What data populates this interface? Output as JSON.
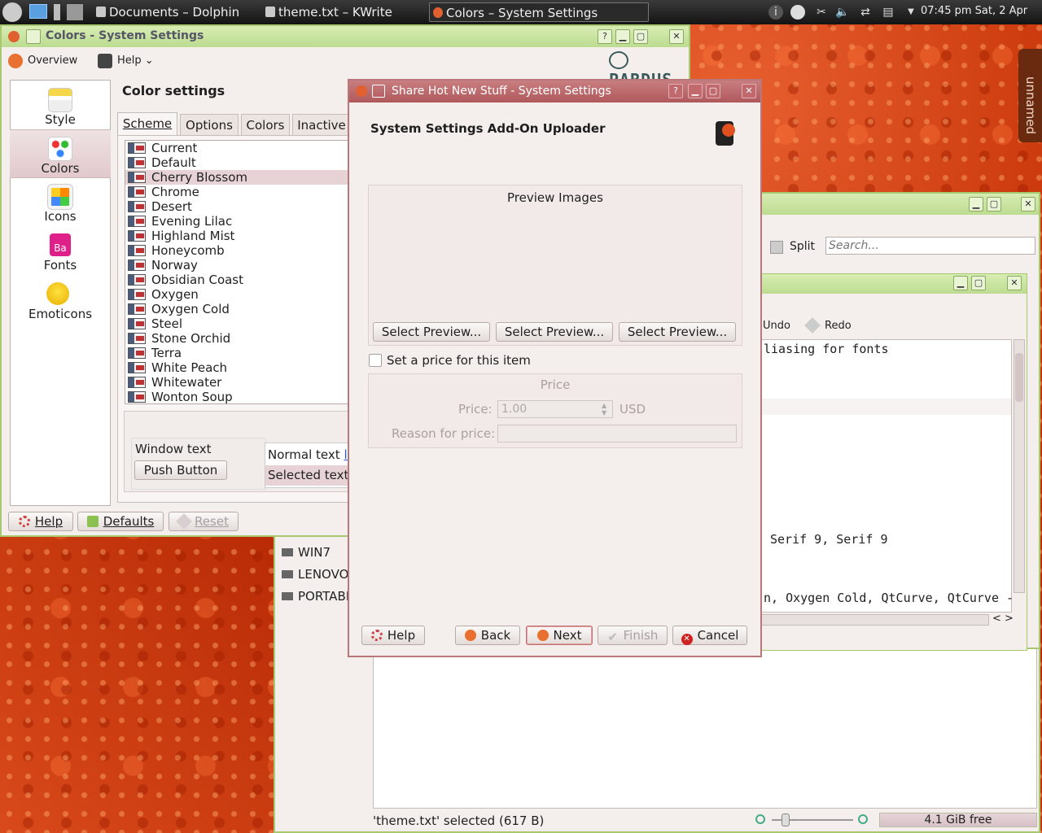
{
  "taskbar": {
    "tasks": [
      "Documents – Dolphin",
      "theme.txt – KWrite",
      "Colors – System Settings"
    ],
    "clock": "07:45 pm Sat, 2 Apr"
  },
  "desktop": {
    "side_tab": "unnamed"
  },
  "colors_window": {
    "title": "Colors - System Settings",
    "toolbar": {
      "overview": "Overview",
      "help": "Help"
    },
    "brand": "PARDUS",
    "categories": [
      {
        "label": "Style"
      },
      {
        "label": "Colors"
      },
      {
        "label": "Icons"
      },
      {
        "label": "Fonts"
      },
      {
        "label": "Emoticons"
      }
    ],
    "fonts_icon_text": "Ba",
    "heading": "Color settings",
    "tabs": [
      "Scheme",
      "Options",
      "Colors",
      "Inactive"
    ],
    "schemes": [
      "Current",
      "Default",
      "Cherry Blossom",
      "Chrome",
      "Desert",
      "Evening Lilac",
      "Highland Mist",
      "Honeycomb",
      "Norway",
      "Obsidian Coast",
      "Oxygen",
      "Oxygen Cold",
      "Steel",
      "Stone Orchid",
      "Terra",
      "White Peach",
      "Whitewater",
      "Wonton Soup"
    ],
    "selected_scheme": "Cherry Blossom",
    "preview": {
      "window_text": "Window text",
      "push_button": "Push Button",
      "normal_text": "Normal text",
      "link_fragment": "li",
      "selected_text": "Selected text"
    },
    "bottom": {
      "help": "Help",
      "defaults": "Defaults",
      "reset": "Reset"
    }
  },
  "kwrite_window": {
    "split": "Split",
    "search_placeholder": "Search...",
    "undo": "Undo",
    "redo": "Redo",
    "lines": [
      "liasing for fonts",
      "Serif 9, Serif 9",
      "n, Oxygen Cold, QtCurve, QtCurve -"
    ],
    "scroll_arrows": "< >"
  },
  "dolphin_window": {
    "places": [
      "WIN7",
      "LENOVO",
      "PORTABL"
    ],
    "status": "'theme.txt' selected (617 B)",
    "free_space": "4.1 GiB free"
  },
  "dialog": {
    "title": "Share Hot New Stuff - System Settings",
    "heading": "System Settings Add-On Uploader",
    "preview_title": "Preview Images",
    "select_preview_buttons": [
      "Select Preview...",
      "Select Preview...",
      "Select Preview..."
    ],
    "price_checkbox": "Set a price for this item",
    "price_checked": false,
    "price_group": "Price",
    "price_label": "Price:",
    "price_value": "1.00",
    "currency": "USD",
    "reason_label": "Reason for price:",
    "reason_value": "",
    "buttons": {
      "help": "Help",
      "back": "Back",
      "next": "Next",
      "finish": "Finish",
      "cancel": "Cancel"
    }
  }
}
